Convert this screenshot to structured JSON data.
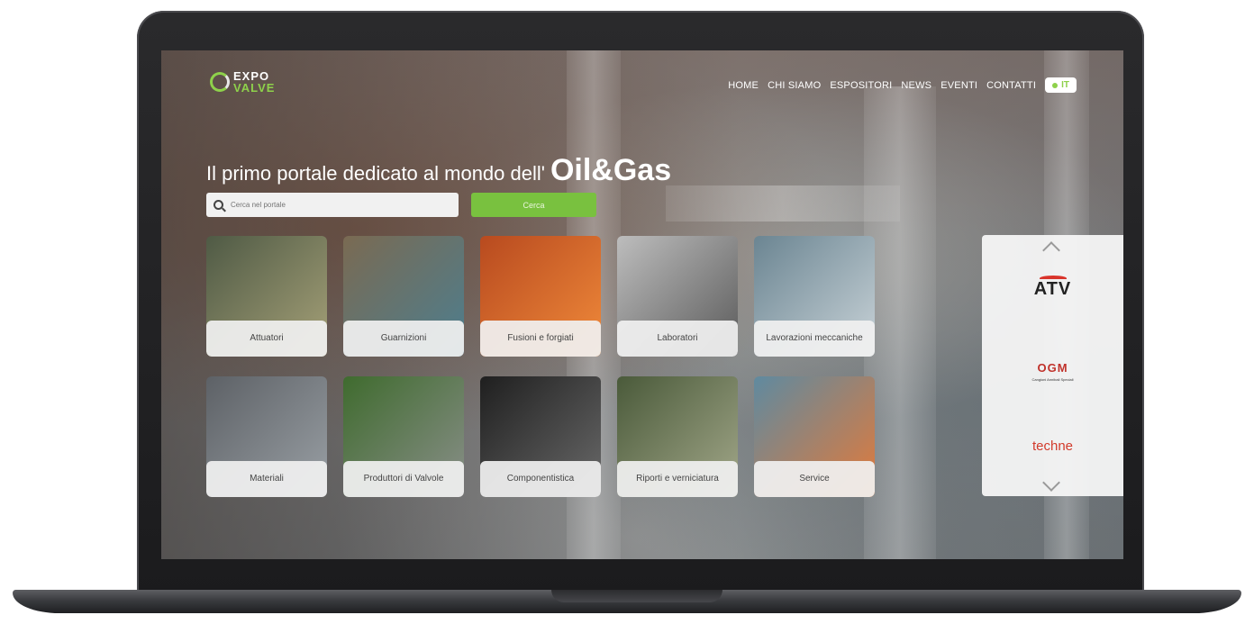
{
  "header": {
    "logo_top": "EXPO",
    "logo_bottom": "VALVE",
    "nav": [
      "HOME",
      "CHI SIAMO",
      "ESPOSITORI",
      "NEWS",
      "EVENTI",
      "CONTATTI"
    ],
    "language": "IT"
  },
  "hero": {
    "title": "Il primo portale dedicato al mondo dell'",
    "accent": "Oil&Gas"
  },
  "search": {
    "placeholder": "Cerca nel portale",
    "button_label": "Cerca"
  },
  "categories": [
    {
      "label": "Attuatori",
      "color_a": "#4f5a45",
      "color_b": "#a6a178"
    },
    {
      "label": "Guarnizioni",
      "color_a": "#7a6a52",
      "color_b": "#4d7e8f"
    },
    {
      "label": "Fusioni e forgiati",
      "color_a": "#b84a1f",
      "color_b": "#f08a3a"
    },
    {
      "label": "Laboratori",
      "color_a": "#bdbdbd",
      "color_b": "#5a5a5a"
    },
    {
      "label": "Lavorazioni meccaniche",
      "color_a": "#6b8592",
      "color_b": "#c9d3d8"
    },
    {
      "label": "Materiali",
      "color_a": "#5d6166",
      "color_b": "#9aa0a5"
    },
    {
      "label": "Produttori di Valvole",
      "color_a": "#3f6b2e",
      "color_b": "#8a8f8a"
    },
    {
      "label": "Componentistica",
      "color_a": "#1f1f1f",
      "color_b": "#6a6a6a"
    },
    {
      "label": "Riporti e verniciatura",
      "color_a": "#4a5a3a",
      "color_b": "#a3a88a"
    },
    {
      "label": "Service",
      "color_a": "#5f8aa0",
      "color_b": "#e37a3a"
    }
  ],
  "exhibitors": [
    {
      "name": "ATV"
    },
    {
      "name": "OGM",
      "sub": "Cangioni Annibali Speciali"
    },
    {
      "name": "techne"
    }
  ],
  "colors": {
    "brand_green": "#8ed14b",
    "button_green": "#79c13f"
  }
}
